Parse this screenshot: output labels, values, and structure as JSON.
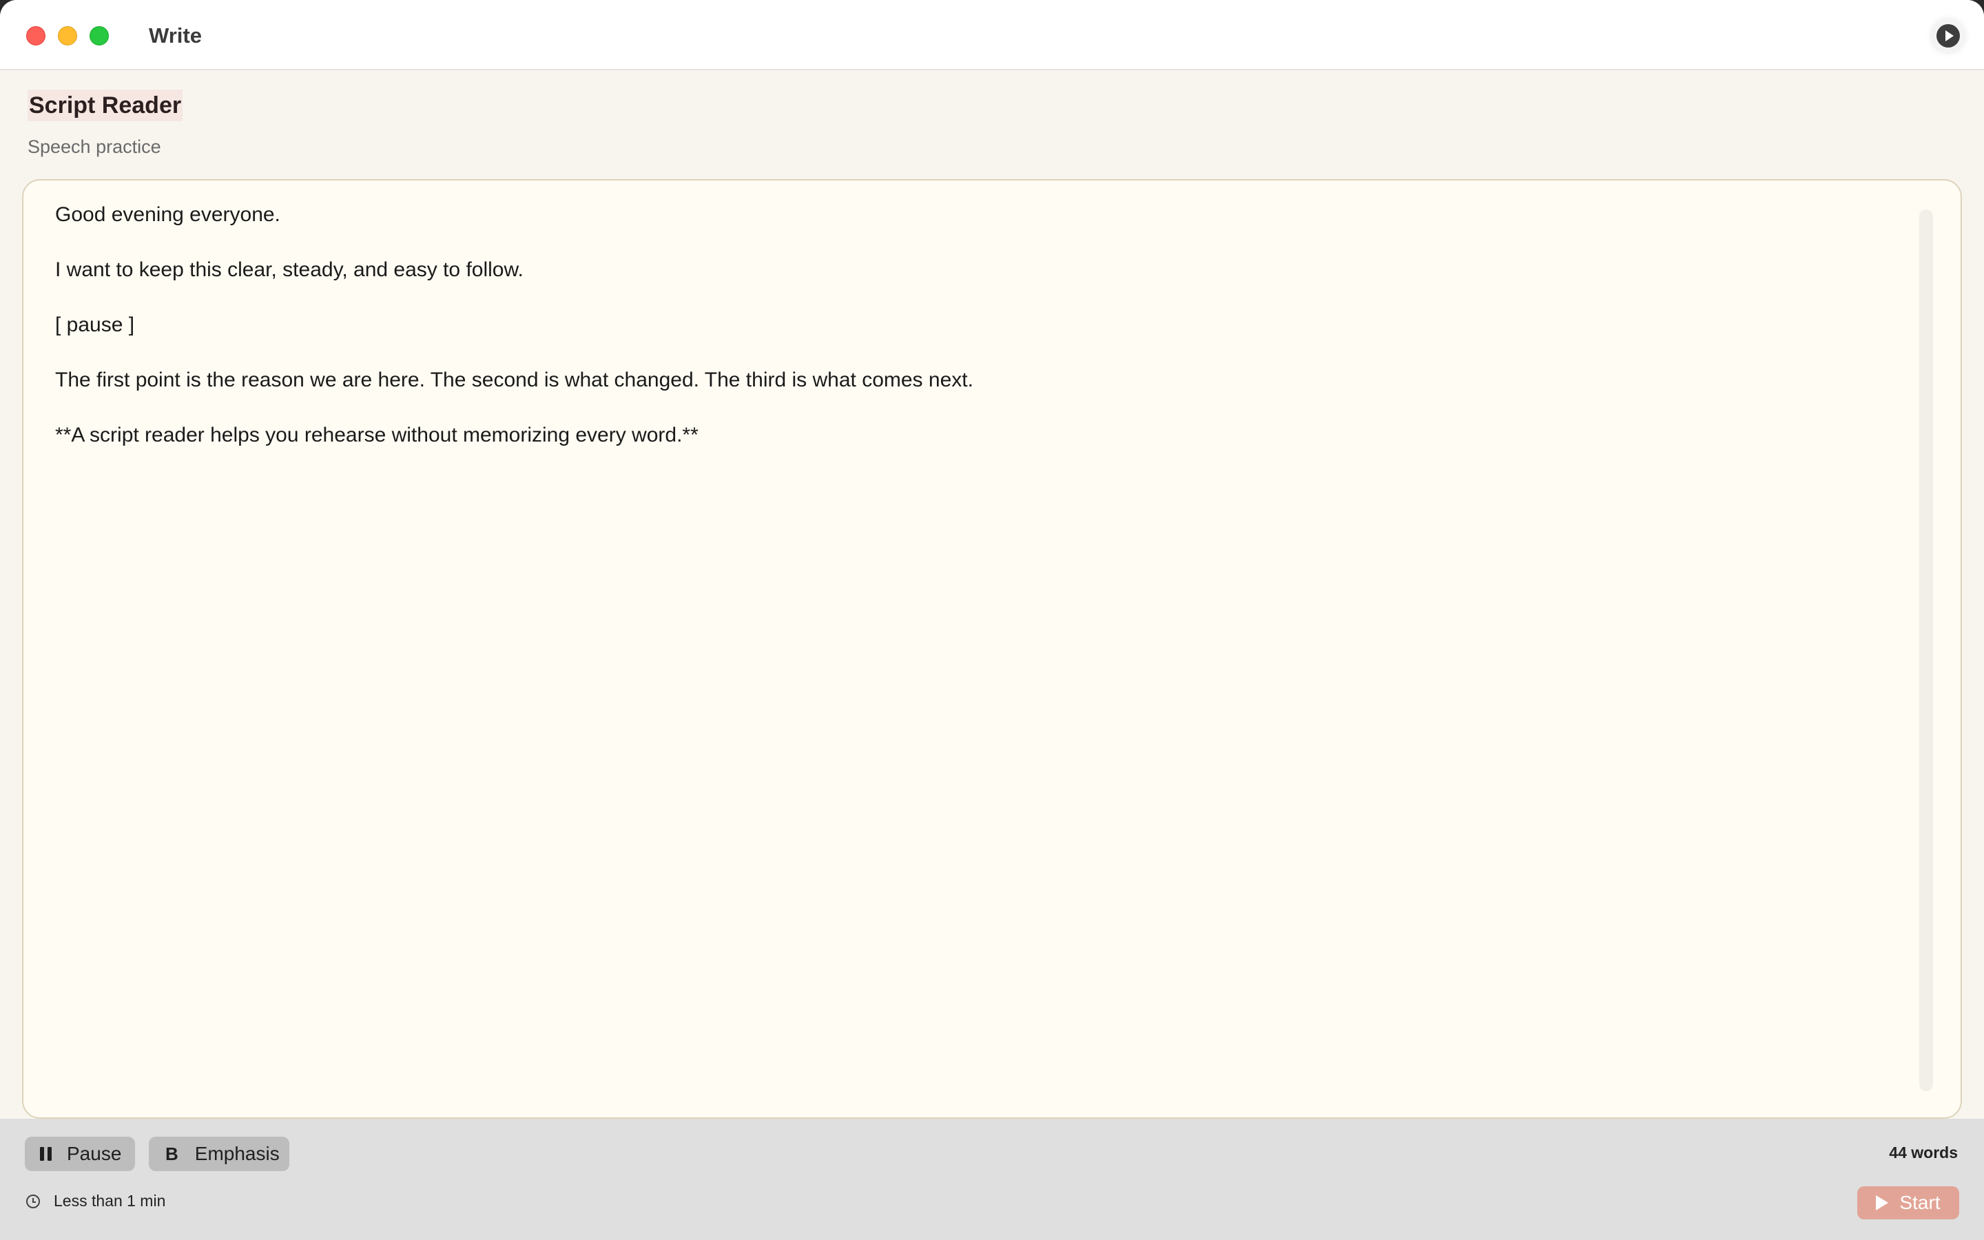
{
  "window": {
    "title": "Write",
    "controls": [
      "close",
      "minimize",
      "maximize"
    ],
    "top_right_icon": "play-circle-icon"
  },
  "header": {
    "title": "Script Reader",
    "subtitle": "Speech practice"
  },
  "editor": {
    "paragraphs": [
      "Good evening everyone.",
      "I want to keep this clear, steady, and easy to follow.",
      "[ pause ]",
      "The first point is the reason we are here. The second is what changed. The third is what comes next.",
      "**A script reader helps you rehearse without memorizing every word.**"
    ]
  },
  "toolbar": {
    "pause_label": "Pause",
    "pause_icon": "pause-icon",
    "emphasis_glyph": "B",
    "emphasis_label": "Emphasis",
    "word_count": "44 words",
    "duration": "Less than 1 min",
    "duration_icon": "clock-icon",
    "start_label": "Start",
    "start_icon": "play-icon"
  },
  "colors": {
    "window_bg": "#f8f5ef",
    "editor_bg": "#fffcf3",
    "editor_border": "#ddd3ba",
    "toolbar_bg": "#dfdfdf",
    "tool_button_bg": "#bdbdbd",
    "start_button_bg": "#e2a496",
    "title_highlight": "#f6e7e2"
  }
}
